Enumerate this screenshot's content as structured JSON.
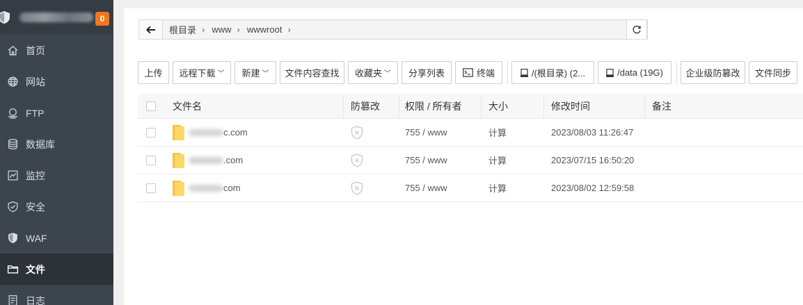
{
  "sidebar": {
    "badge": "0",
    "items": [
      {
        "label": "首页",
        "icon": "home-icon"
      },
      {
        "label": "网站",
        "icon": "globe-icon"
      },
      {
        "label": "FTP",
        "icon": "ftp-icon"
      },
      {
        "label": "数据库",
        "icon": "database-icon"
      },
      {
        "label": "监控",
        "icon": "monitor-icon"
      },
      {
        "label": "安全",
        "icon": "shield-check-icon"
      },
      {
        "label": "WAF",
        "icon": "waf-shield-icon"
      },
      {
        "label": "文件",
        "icon": "folder-icon"
      },
      {
        "label": "日志",
        "icon": "log-icon"
      }
    ]
  },
  "path": {
    "crumbs": [
      "根目录",
      "www",
      "wwwroot"
    ]
  },
  "toolbar": {
    "upload": "上传",
    "remote_download": "远程下载",
    "new": "新建",
    "content_search": "文件内容查找",
    "favorites": "收藏夹",
    "share_list": "分享列表",
    "terminal": "终端",
    "disk_root": "/(根目录) (2...",
    "disk_data": "/data (19G)",
    "tamper_proof": "企业级防篡改",
    "file_sync": "文件同步"
  },
  "table": {
    "headers": {
      "name": "文件名",
      "fang": "防篡改",
      "perm": "权限 / 所有者",
      "size": "大小",
      "mtime": "修改时间",
      "note": "备注"
    },
    "rows": [
      {
        "name_suffix": "c.com",
        "perm": "755 / www",
        "size": "计算",
        "mtime": "2023/08/03 11:26:47"
      },
      {
        "name_suffix": ".com",
        "perm": "755 / www",
        "size": "计算",
        "mtime": "2023/07/15 16:50:20"
      },
      {
        "name_suffix": "com",
        "perm": "755 / www",
        "size": "计算",
        "mtime": "2023/08/02 12:59:58"
      }
    ]
  },
  "colors": {
    "sidebar_bg": "#3c444d",
    "accent_green": "#20a53a",
    "badge_orange": "#f0771f"
  }
}
